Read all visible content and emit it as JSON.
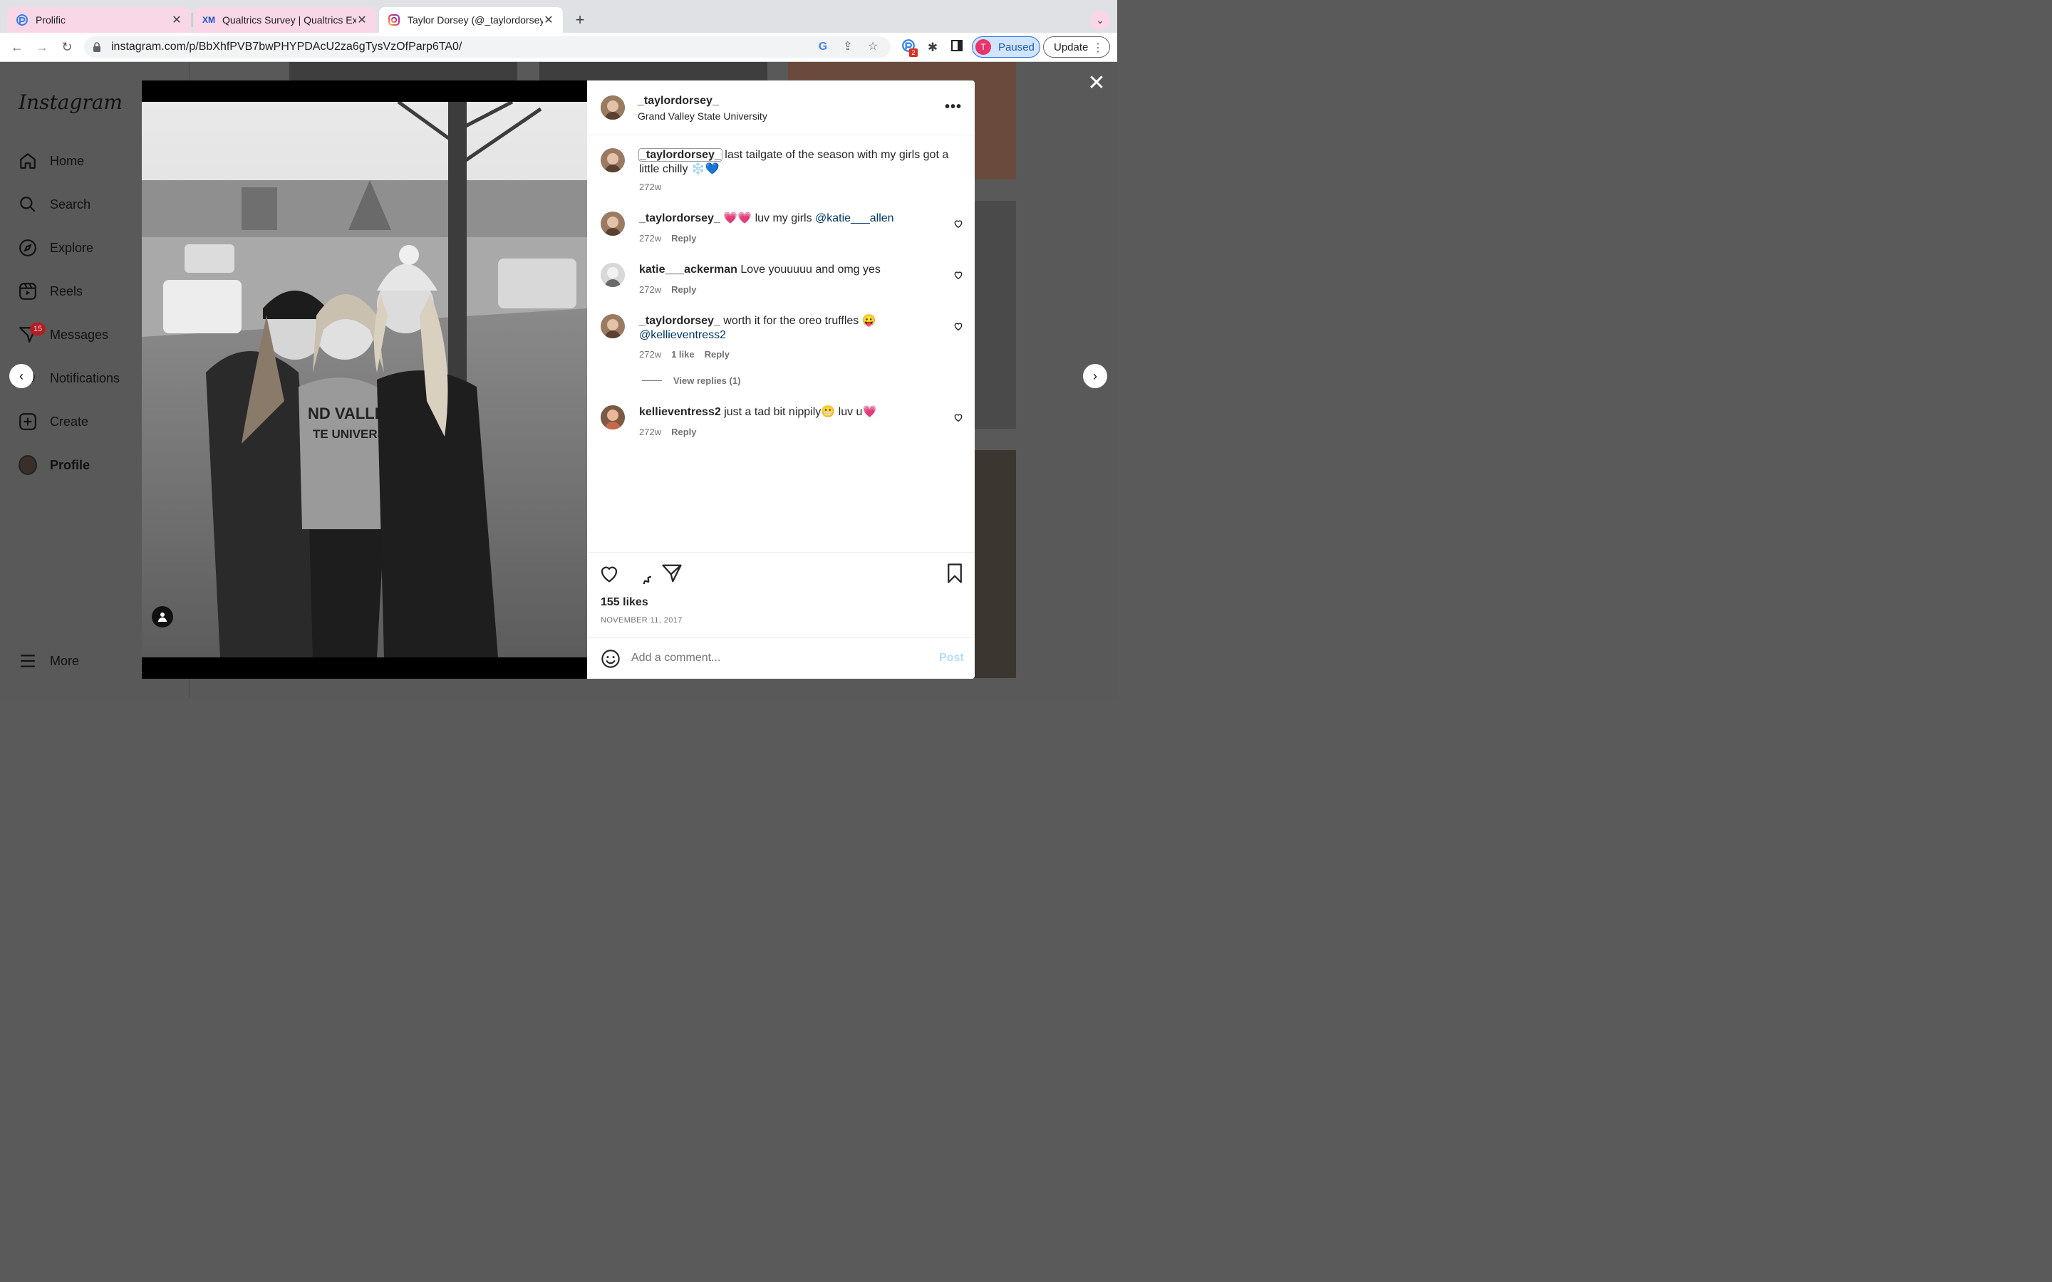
{
  "browser": {
    "tabs": [
      {
        "title": "Prolific"
      },
      {
        "title": "Qualtrics Survey | Qualtrics Exp"
      },
      {
        "title": "Taylor Dorsey (@_taylordorsey"
      }
    ],
    "url": "instagram.com/p/BbXhfPVB7bwPHYPDAcU2za6gTysVzOfParp6TA0/",
    "profile_initial": "T",
    "profile_status": "Paused",
    "update_label": "Update",
    "extension_badge": "2"
  },
  "instagram": {
    "logo": "Instagram",
    "nav": [
      {
        "label": "Home"
      },
      {
        "label": "Search"
      },
      {
        "label": "Explore"
      },
      {
        "label": "Reels"
      },
      {
        "label": "Messages"
      },
      {
        "label": "Notifications"
      },
      {
        "label": "Create"
      },
      {
        "label": "Profile"
      }
    ],
    "more_label": "More",
    "messages_badge": "15"
  },
  "post": {
    "username": "_taylordorsey_",
    "location": "Grand Valley State University",
    "caption": {
      "user": "_taylordorsey_",
      "text": " last tailgate of the season with my girls got a little chilly ❄️💙",
      "age": "272w"
    },
    "comments": [
      {
        "user": "_taylordorsey_",
        "text": " 💗💗 luv my girls ",
        "mention": "@katie___allen",
        "age": "272w",
        "likes": "",
        "reply": "Reply"
      },
      {
        "user": "katie___ackerman",
        "text": " Love youuuuu and omg yes",
        "mention": "",
        "age": "272w",
        "likes": "",
        "reply": "Reply"
      },
      {
        "user": "_taylordorsey_",
        "text": " worth it for the oreo truffles 😛 ",
        "mention": "@kellieventress2",
        "age": "272w",
        "likes": "1 like",
        "reply": "Reply"
      },
      {
        "user": "kellieventress2",
        "text": " just a tad bit nippily😬 luv u💗",
        "mention": "",
        "age": "272w",
        "likes": "",
        "reply": "Reply"
      }
    ],
    "view_replies": "View replies (1)",
    "likes": "155 likes",
    "date": "NOVEMBER 11, 2017",
    "comment_placeholder": "Add a comment...",
    "post_label": "Post",
    "colors": {
      "mention": "#00376b",
      "post_disabled": "#b2dffc",
      "badge": "#b31c22"
    },
    "icons": [
      "heart-icon",
      "comment-icon",
      "share-icon",
      "bookmark-icon",
      "emoji-icon",
      "more-icon",
      "close-icon"
    ]
  }
}
